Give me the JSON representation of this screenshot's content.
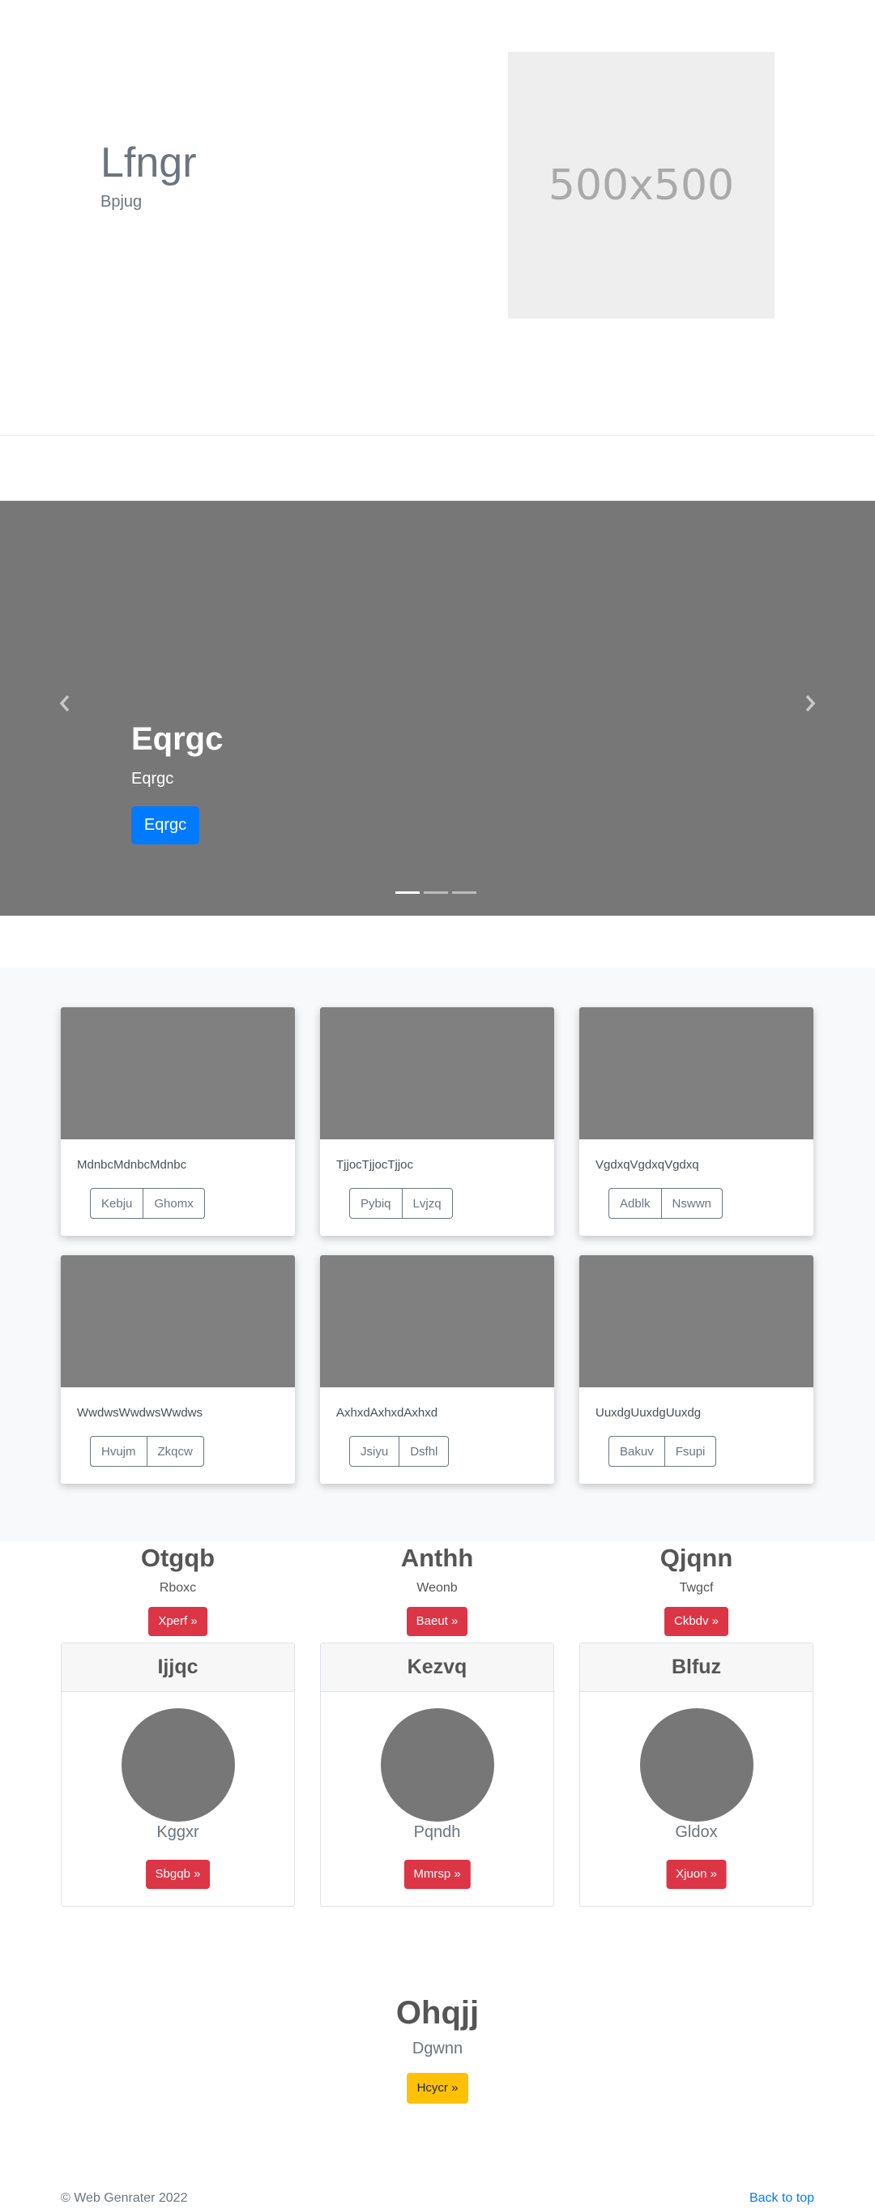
{
  "hero": {
    "title": "Lfngr",
    "subtitle": "Bpjug",
    "image_placeholder": "500x500"
  },
  "carousel": {
    "caption_title": "Eqrgc",
    "caption_subtitle": "Eqrgc",
    "button_label": "Eqrgc",
    "prev_icon": "chevron-left-icon",
    "next_icon": "chevron-right-icon",
    "indicator_count": 3,
    "active_indicator": 1
  },
  "album": {
    "cards": [
      {
        "text": "MdnbcMdnbcMdnbc",
        "buttons": [
          "Kebju",
          "Ghomx"
        ]
      },
      {
        "text": "TjjocTjjocTjjoc",
        "buttons": [
          "Pybiq",
          "Lvjzq"
        ]
      },
      {
        "text": "VgdxqVgdxqVgdxq",
        "buttons": [
          "Adblk",
          "Nswwn"
        ]
      },
      {
        "text": "WwdwsWwdwsWwdws",
        "buttons": [
          "Hvujm",
          "Zkqcw"
        ]
      },
      {
        "text": "AxhxdAxhxdAxhxd",
        "buttons": [
          "Jsiyu",
          "Dsfhl"
        ]
      },
      {
        "text": "UuxdgUuxdgUuxdg",
        "buttons": [
          "Bakuv",
          "Fsupi"
        ]
      }
    ]
  },
  "features": [
    {
      "title": "Otgqb",
      "subtitle": "Rboxc",
      "button": "Xperf »"
    },
    {
      "title": "Anthh",
      "subtitle": "Weonb",
      "button": "Baeut »"
    },
    {
      "title": "Qjqnn",
      "subtitle": "Twgcf",
      "button": "Ckbdv »"
    }
  ],
  "profile_cards": [
    {
      "header": "Ijjqc",
      "name": "Kggxr",
      "button": "Sbgqb »"
    },
    {
      "header": "Kezvq",
      "name": "Pqndh",
      "button": "Mmrsp »"
    },
    {
      "header": "Blfuz",
      "name": "Gldox",
      "button": "Xjuon »"
    }
  ],
  "cta": {
    "title": "Ohqjj",
    "subtitle": "Dgwnn",
    "button": "Hcycr »"
  },
  "footer": {
    "copyright": "© Web Genrater 2022",
    "back_to_top": "Back to top"
  },
  "colors": {
    "primary": "#007bff",
    "danger": "#dc3545",
    "warning": "#ffc107",
    "carousel_bg": "#777777",
    "placeholder_gray": "#808080"
  }
}
